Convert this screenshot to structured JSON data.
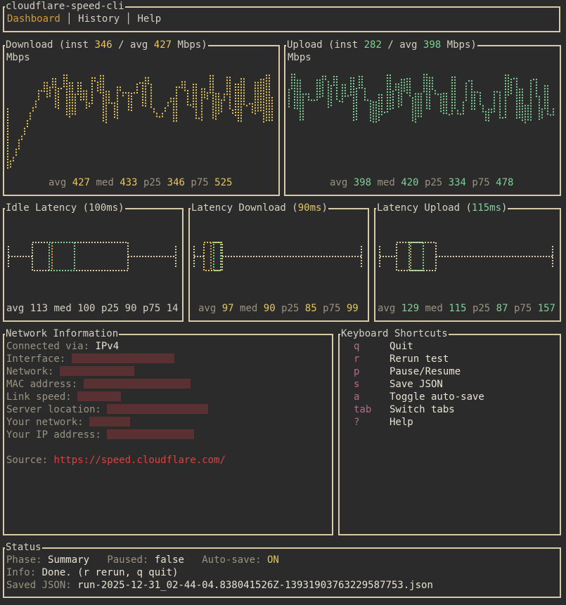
{
  "app": {
    "title": "cloudflare-speed-cli"
  },
  "tabs": [
    {
      "label": "Dashboard",
      "active": true
    },
    {
      "label": "History",
      "active": false
    },
    {
      "label": "Help",
      "active": false
    }
  ],
  "download": {
    "label": "Download",
    "inst_label": "inst",
    "inst": "346",
    "avg_label": "avg",
    "avg": "427",
    "unit": "Mbps",
    "axis_unit": "Mbps",
    "stats": {
      "avg": "427",
      "med": "433",
      "p25": "346",
      "p75": "525"
    }
  },
  "upload": {
    "label": "Upload",
    "inst_label": "inst",
    "inst": "282",
    "avg_label": "avg",
    "avg": "398",
    "unit": "Mbps",
    "axis_unit": "Mbps",
    "stats": {
      "avg": "398",
      "med": "420",
      "p25": "334",
      "p75": "478"
    }
  },
  "latency_idle": {
    "label": "Idle Latency",
    "value": "100ms",
    "stats": {
      "avg": "113",
      "med": "100",
      "p25": "90",
      "p75": "14"
    }
  },
  "latency_download": {
    "label": "Latency Download",
    "value": "90ms",
    "stats": {
      "avg": "97",
      "med": "90",
      "p25": "85",
      "p75": "99"
    }
  },
  "latency_upload": {
    "label": "Latency Upload",
    "value": "115ms",
    "stats": {
      "avg": "129",
      "med": "115",
      "p25": "87",
      "p75": "157"
    }
  },
  "stat_labels": {
    "avg": "avg",
    "med": "med",
    "p25": "p25",
    "p75": "p75"
  },
  "network": {
    "title": "Network Information",
    "connected_label": "Connected via:",
    "connected_value": "IPv4",
    "interface_label": "Interface:",
    "network_label": "Network:",
    "mac_label": "MAC address:",
    "link_label": "Link speed:",
    "server_label": "Server location:",
    "your_network_label": "Your network:",
    "ip_label": "Your IP address:",
    "source_label": "Source:",
    "source_url": "https://speed.cloudflare.com/"
  },
  "shortcuts": {
    "title": "Keyboard Shortcuts",
    "items": [
      {
        "key": "q",
        "action": "Quit"
      },
      {
        "key": "r",
        "action": "Rerun test"
      },
      {
        "key": "p",
        "action": "Pause/Resume"
      },
      {
        "key": "s",
        "action": "Save JSON"
      },
      {
        "key": "a",
        "action": "Toggle auto-save"
      },
      {
        "key": "tab",
        "action": "Switch tabs"
      },
      {
        "key": "?",
        "action": "Help"
      }
    ]
  },
  "status": {
    "title": "Status",
    "phase_label": "Phase:",
    "phase": "Summary",
    "paused_label": "Paused:",
    "paused": "false",
    "autosave_label": "Auto-save:",
    "autosave": "ON",
    "info_label": "Info:",
    "info": "Done. (r rerun, q quit)",
    "saved_label": "Saved JSON:",
    "saved": "run-2025-12-31_02-44-04.838041526Z-13931903763229587753.json"
  },
  "colors": {
    "download": "#e6c560",
    "upload": "#7fcf97",
    "median": "#d69a39",
    "border": "#d6cba6"
  }
}
